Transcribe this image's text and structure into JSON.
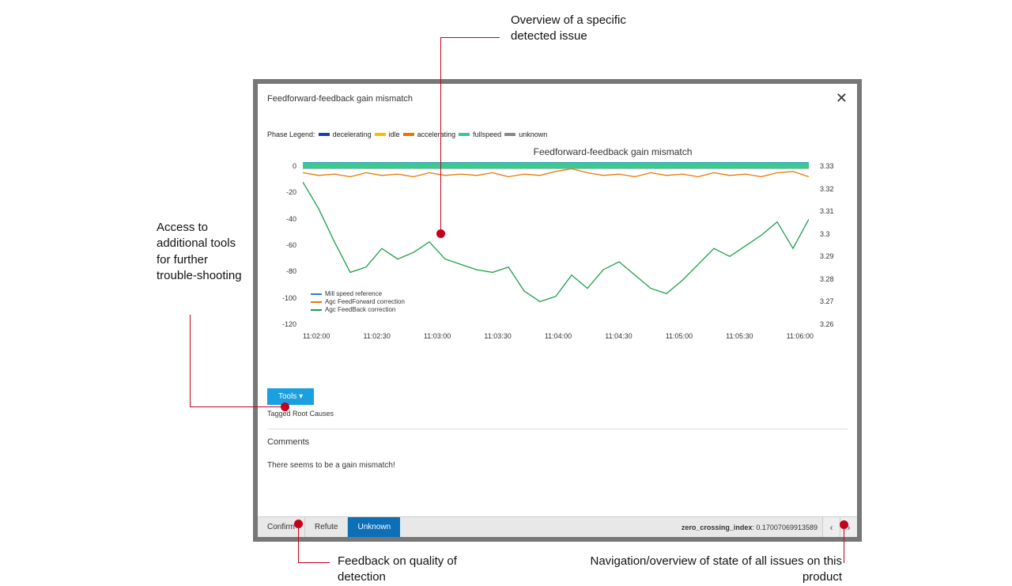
{
  "annotations": {
    "overview": "Overview of a specific detected issue",
    "tools": "Access to additional tools for further trouble-shooting",
    "feedback": "Feedback on quality of detection",
    "navigation": "Navigation/overview of state of all issues on this product"
  },
  "modal": {
    "title": "Feedforward-feedback gain mismatch",
    "close": "✕",
    "phase_legend_label": "Phase Legend:",
    "phases": {
      "decelerating": "decelerating",
      "idle": "idle",
      "accelerating": "accelerating",
      "fullspeed": "fullspeed",
      "unknown": "unknown"
    },
    "phase_colors": {
      "decelerating": "#1c3fa8",
      "idle": "#f2c200",
      "accelerating": "#e97600",
      "fullspeed": "#3ac98f",
      "unknown": "#888888"
    },
    "tools_button": "Tools ▾",
    "tagged_root_causes": "Tagged Root Causes",
    "comments_header": "Comments",
    "comment_text": "There seems to be a gain mismatch!",
    "feedback_buttons": {
      "confirm": "Confirm",
      "refute": "Refute",
      "unknown": "Unknown"
    },
    "metric_label": "zero_crossing_index",
    "metric_value": "0.17007069913589",
    "nav_prev": "‹",
    "nav_next": "›"
  },
  "chart_data": {
    "type": "line",
    "title": "Feedforward-feedback gain mismatch",
    "x_ticks": [
      "11:02:00",
      "11:02:30",
      "11:03:00",
      "11:03:30",
      "11:04:00",
      "11:04:30",
      "11:05:00",
      "11:05:30",
      "11:06:00"
    ],
    "y_left": {
      "label": "",
      "ticks": [
        0,
        -20,
        -40,
        -60,
        -80,
        -100,
        -120
      ],
      "range": [
        -120,
        5
      ]
    },
    "y_right": {
      "label": "",
      "ticks": [
        3.33,
        3.32,
        3.31,
        3.3,
        3.29,
        3.28,
        3.27,
        3.26
      ],
      "range": [
        3.26,
        3.33
      ]
    },
    "phase_band_color": "#3ac98f",
    "series": [
      {
        "name": "Mill speed reference",
        "axis": "right",
        "color": "#2e7bd6",
        "values": [
          3.33,
          3.33,
          3.33,
          3.33,
          3.33,
          3.33,
          3.33,
          3.33,
          3.33,
          3.33,
          3.33,
          3.33,
          3.33,
          3.33,
          3.33,
          3.33,
          3.33,
          3.33,
          3.33,
          3.33,
          3.33,
          3.33,
          3.33,
          3.33,
          3.33,
          3.33,
          3.33,
          3.33,
          3.33,
          3.33,
          3.33,
          3.33,
          3.33
        ]
      },
      {
        "name": "Agc FeedForward correction",
        "axis": "left",
        "color": "#e97600",
        "values": [
          -3,
          -5,
          -4,
          -6,
          -3,
          -5,
          -4,
          -6,
          -3,
          -5,
          -4,
          -5,
          -3,
          -6,
          -4,
          -5,
          -2,
          0,
          -3,
          -5,
          -4,
          -6,
          -3,
          -5,
          -4,
          -6,
          -3,
          -5,
          -4,
          -6,
          -3,
          -2,
          -6
        ]
      },
      {
        "name": "Agc FeedBack correction",
        "axis": "left",
        "color": "#1e9e4a",
        "values": [
          -10,
          -30,
          -55,
          -78,
          -74,
          -60,
          -68,
          -63,
          -55,
          -68,
          -72,
          -76,
          -78,
          -74,
          -92,
          -100,
          -96,
          -80,
          -90,
          -76,
          -70,
          -80,
          -90,
          -94,
          -84,
          -72,
          -60,
          -66,
          -58,
          -50,
          -40,
          -60,
          -38
        ]
      }
    ],
    "legend_entries": [
      "Mill speed reference",
      "Agc FeedForward correction",
      "Agc FeedBack correction"
    ]
  }
}
